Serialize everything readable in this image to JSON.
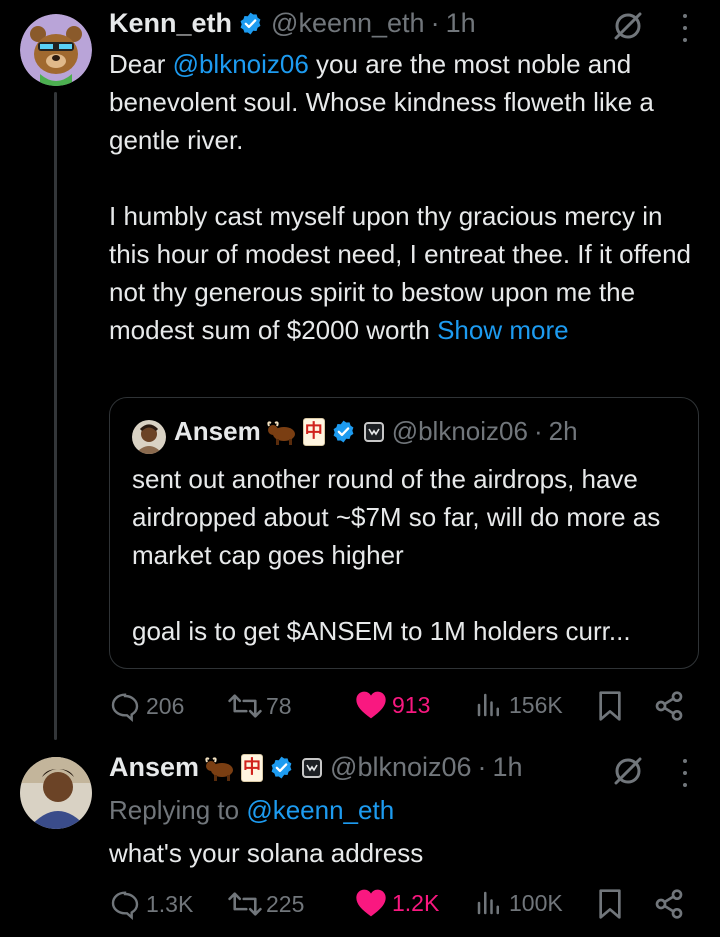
{
  "tweet1": {
    "author_name": "Kenn_eth",
    "handle": "@keenn_eth",
    "separator": "·",
    "time": "1h",
    "text_prefix": "Dear ",
    "text_mention": "@blknoiz06",
    "text_line_rest": " you are the most noble and benevolent soul. Whose kindness floweth like a gentle river.",
    "text_para2": "I humbly cast myself upon thy gracious mercy in this hour of modest need, I entreat thee. If it offend not thy generous spirit to bestow upon me the modest sum of $2000 worth ",
    "show_more": "Show more",
    "quote": {
      "author_name": "Ansem",
      "handle": "@blknoiz06",
      "separator": "·",
      "time": "2h",
      "text_para1": "sent out another round of the airdrops, have airdropped about ~$7M so far, will do more as market cap goes higher",
      "text_para2": "goal is to get $ANSEM to 1M holders curr..."
    },
    "actions": {
      "replies": "206",
      "reposts": "78",
      "likes": "913",
      "views": "156K"
    }
  },
  "tweet2": {
    "author_name": "Ansem",
    "handle": "@blknoiz06",
    "separator": "·",
    "time": "1h",
    "replying_prefix": "Replying to ",
    "replying_handle": "@keenn_eth",
    "text": "what's your solana address",
    "actions": {
      "replies": "1.3K",
      "reposts": "225",
      "likes": "1.2K",
      "views": "100K"
    }
  },
  "emoji": {
    "mahjong_char": "中"
  },
  "colors": {
    "background": "#000000",
    "text": "#e7e9ea",
    "muted": "#71767b",
    "link": "#1d9bf0",
    "like": "#f91880",
    "verified": "#1d9bf0"
  },
  "icons": [
    "verified-badge-icon",
    "grok-icon",
    "more-options-icon",
    "reply-icon",
    "repost-icon",
    "like-heart-icon",
    "views-icon",
    "bookmark-icon",
    "share-icon",
    "bull-emoji-icon",
    "mahjong-tile-icon",
    "affiliate-badge-icon"
  ]
}
